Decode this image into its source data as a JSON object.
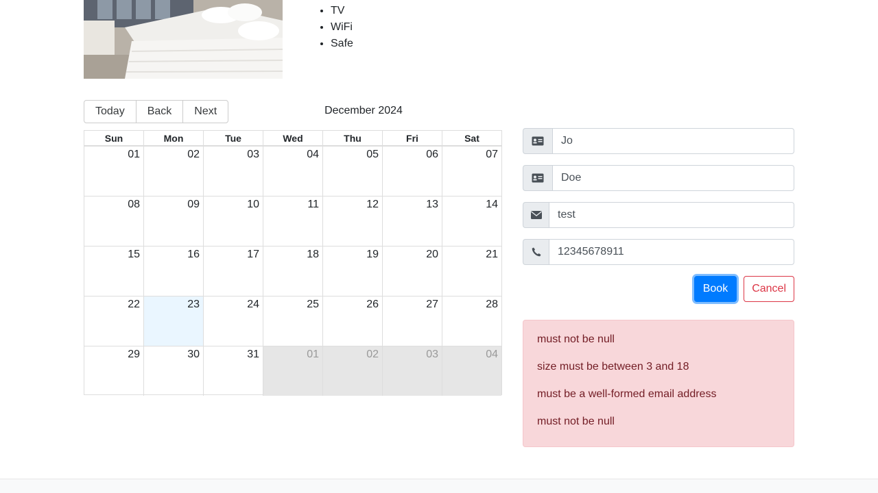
{
  "room": {
    "photo_icon": "hotel-room-photo",
    "features": [
      "TV",
      "WiFi",
      "Safe"
    ]
  },
  "calendar": {
    "buttons": {
      "today": "Today",
      "back": "Back",
      "next": "Next"
    },
    "label": "December 2024",
    "weekdays": [
      "Sun",
      "Mon",
      "Tue",
      "Wed",
      "Thu",
      "Fri",
      "Sat"
    ],
    "weeks": [
      [
        "01",
        "02",
        "03",
        "04",
        "05",
        "06",
        "07"
      ],
      [
        "08",
        "09",
        "10",
        "11",
        "12",
        "13",
        "14"
      ],
      [
        "15",
        "16",
        "17",
        "18",
        "19",
        "20",
        "21"
      ],
      [
        "22",
        "23",
        "24",
        "25",
        "26",
        "27",
        "28"
      ],
      [
        "29",
        "30",
        "31",
        "01",
        "02",
        "03",
        "04"
      ]
    ],
    "highlight_color": "#eaf6ff",
    "off_range_color": "#e6e6e6"
  },
  "form": {
    "firstname": {
      "value": "Jo",
      "icon": "id-card-icon"
    },
    "lastname": {
      "value": "Doe",
      "icon": "id-card-icon"
    },
    "email": {
      "value": "test",
      "icon": "envelope-icon"
    },
    "phone": {
      "value": "12345678911",
      "icon": "phone-icon"
    },
    "book_label": "Book",
    "cancel_label": "Cancel",
    "primary_color": "#007bff",
    "danger_color": "#dc3545"
  },
  "errors": [
    "must not be null",
    "size must be between 3 and 18",
    "must be a well-formed email address",
    "must not be null"
  ]
}
